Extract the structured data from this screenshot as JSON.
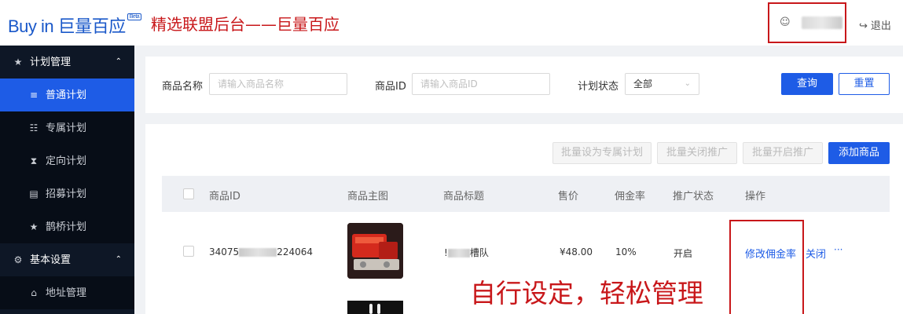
{
  "header": {
    "logo_text": "Buy in 巨量百应",
    "logo_badge": "Beta",
    "banner": "精选联盟后台——巨量百应",
    "logout_label": "退出"
  },
  "sidebar": {
    "items": [
      {
        "label": "计划管理",
        "icon": "plan-icon",
        "type": "group"
      },
      {
        "label": "普通计划",
        "icon": "list-icon",
        "type": "sub-active"
      },
      {
        "label": "专属计划",
        "icon": "gift-icon",
        "type": "sub"
      },
      {
        "label": "定向计划",
        "icon": "hourglass-icon",
        "type": "sub"
      },
      {
        "label": "招募计划",
        "icon": "recruit-icon",
        "type": "sub"
      },
      {
        "label": "鹊桥计划",
        "icon": "bridge-icon",
        "type": "sub"
      },
      {
        "label": "基本设置",
        "icon": "gear-icon",
        "type": "group"
      },
      {
        "label": "地址管理",
        "icon": "home-icon",
        "type": "sub"
      }
    ]
  },
  "search": {
    "name_label": "商品名称",
    "name_placeholder": "请输入商品名称",
    "id_label": "商品ID",
    "id_placeholder": "请输入商品ID",
    "status_label": "计划状态",
    "status_value": "全部",
    "query_btn": "查询",
    "reset_btn": "重置"
  },
  "actions": {
    "batch_exclusive": "批量设为专属计划",
    "batch_close": "批量关闭推广",
    "batch_open": "批量开启推广",
    "add_product": "添加商品"
  },
  "table": {
    "columns": [
      "商品ID",
      "商品主图",
      "商品标题",
      "售价",
      "佣金率",
      "推广状态",
      "操作"
    ],
    "rows": [
      {
        "id_prefix": "34075",
        "id_suffix": "224064",
        "title_prefix": "!",
        "title_suffix": "槽队",
        "price": "¥48.00",
        "commission": "10%",
        "status": "开启",
        "edit_action": "修改佣金率",
        "close_action": "关闭",
        "more": "···"
      }
    ]
  },
  "annotation": {
    "text": "自行设定，轻松管理"
  },
  "colors": {
    "accent": "#1e5ce6",
    "sidebar_bg": "#0e1726",
    "annotation_red": "#c8171a"
  }
}
